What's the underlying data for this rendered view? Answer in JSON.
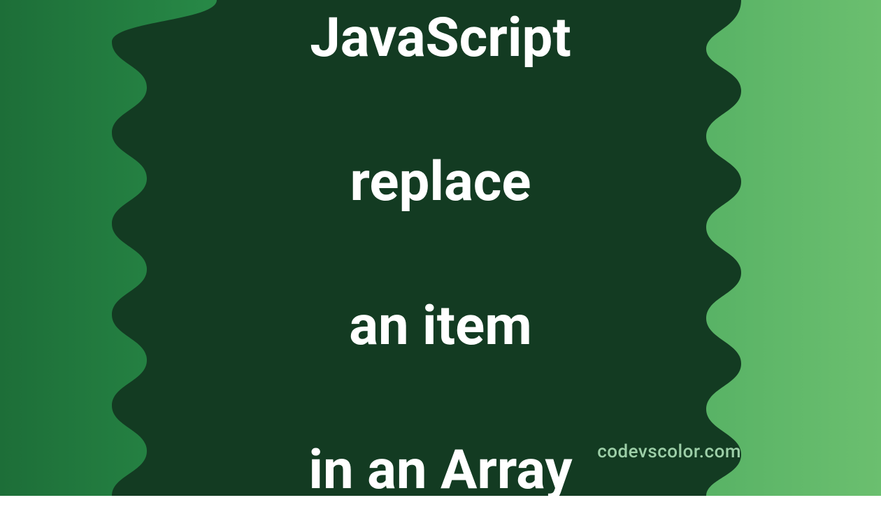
{
  "title": {
    "line1": "JavaScript",
    "line2": "replace",
    "line3": "an item",
    "line4": "in an Array"
  },
  "watermark": "codevscolor.com",
  "colors": {
    "blob": "#133b22",
    "text": "#ffffff",
    "watermark": "#9dcfa8"
  }
}
